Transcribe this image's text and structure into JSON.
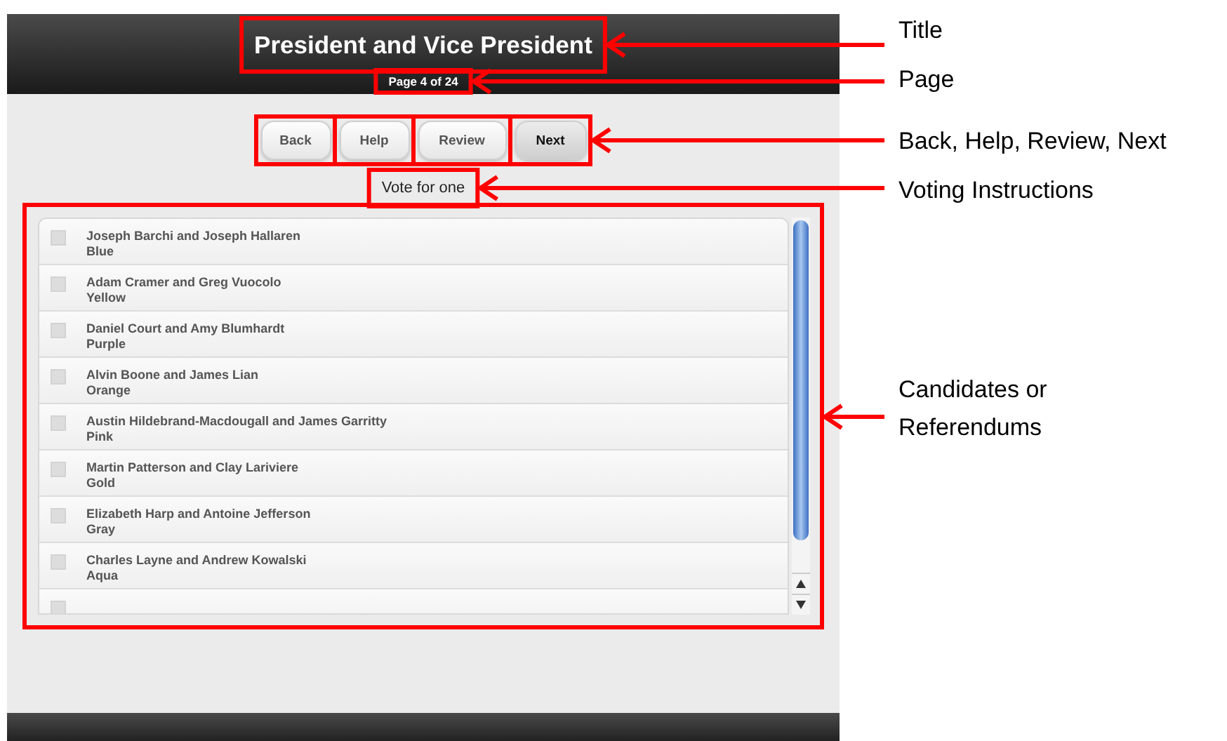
{
  "header": {
    "title": "President and Vice President",
    "page": "Page 4 of 24"
  },
  "buttons": [
    {
      "label": "Back",
      "kind": "default"
    },
    {
      "label": "Help",
      "kind": "default"
    },
    {
      "label": "Review",
      "kind": "default"
    },
    {
      "label": "Next",
      "kind": "primary"
    }
  ],
  "instructions": "Vote for one",
  "candidates": [
    {
      "name": "Joseph Barchi and Joseph Hallaren",
      "party": "Blue",
      "checked": false
    },
    {
      "name": "Adam Cramer and Greg Vuocolo",
      "party": "Yellow",
      "checked": false
    },
    {
      "name": "Daniel Court and Amy Blumhardt",
      "party": "Purple",
      "checked": false
    },
    {
      "name": "Alvin Boone and James Lian",
      "party": "Orange",
      "checked": false
    },
    {
      "name": "Austin Hildebrand-Macdougall and James Garritty",
      "party": "Pink",
      "checked": false
    },
    {
      "name": "Martin Patterson and Clay Lariviere",
      "party": "Gold",
      "checked": false
    },
    {
      "name": "Elizabeth Harp and Antoine Jefferson",
      "party": "Gray",
      "checked": false
    },
    {
      "name": "Charles Layne and Andrew Kowalski",
      "party": "Aqua",
      "checked": false
    },
    {
      "checked": false
    }
  ],
  "annotations": [
    {
      "label": "Title"
    },
    {
      "label": "Page"
    },
    {
      "label": "Back, Help, Review, Next"
    },
    {
      "label": "Voting Instructions"
    },
    {
      "label": "Candidates or Referendums"
    }
  ]
}
